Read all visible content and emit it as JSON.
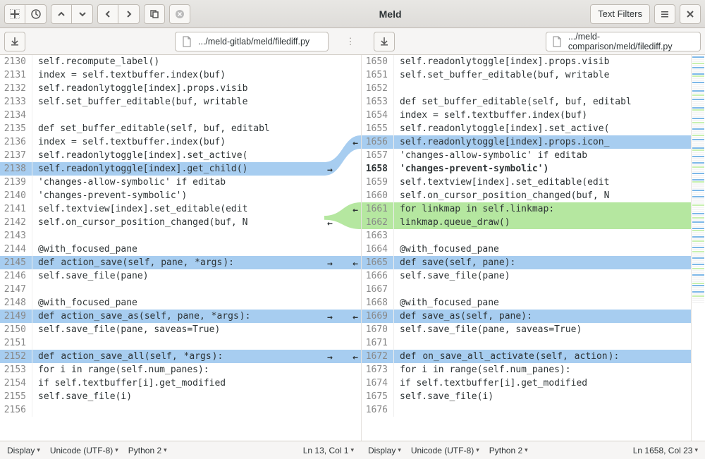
{
  "header": {
    "title": "Meld",
    "text_filters": "Text Filters"
  },
  "files": {
    "left": ".../meld-gitlab/meld/filediff.py",
    "right": ".../meld-comparison/meld/filediff.py"
  },
  "status": {
    "left": {
      "display": "Display",
      "encoding": "Unicode (UTF-8)",
      "lang": "Python 2",
      "pos": "Ln 13, Col 1"
    },
    "right": {
      "display": "Display",
      "encoding": "Unicode (UTF-8)",
      "lang": "Python 2",
      "pos": "Ln 1658, Col 23"
    }
  },
  "left_lines": [
    {
      "n": 2130,
      "t": "        self.recompute_label()",
      "bg": ""
    },
    {
      "n": 2131,
      "t": "        index = self.textbuffer.index(buf)",
      "bg": ""
    },
    {
      "n": 2132,
      "t": "        self.readonlytoggle[index].props.visib",
      "bg": ""
    },
    {
      "n": 2133,
      "t": "        self.set_buffer_editable(buf, writable",
      "bg": ""
    },
    {
      "n": 2134,
      "t": "",
      "bg": ""
    },
    {
      "n": 2135,
      "t": "    def set_buffer_editable(self, buf, editabl",
      "bg": ""
    },
    {
      "n": 2136,
      "t": "        index = self.textbuffer.index(buf)",
      "bg": ""
    },
    {
      "n": 2137,
      "t": "        self.readonlytoggle[index].set_active(",
      "bg": ""
    },
    {
      "n": 2138,
      "t": "        self.readonlytoggle[index].get_child()",
      "bg": "blue",
      "arrow_r": true
    },
    {
      "n": 2139,
      "t": "            'changes-allow-symbolic' if editab",
      "bg": ""
    },
    {
      "n": 2140,
      "t": "            'changes-prevent-symbolic')",
      "bg": ""
    },
    {
      "n": 2141,
      "t": "        self.textview[index].set_editable(edit",
      "bg": ""
    },
    {
      "n": 2142,
      "t": "        self.on_cursor_position_changed(buf, N",
      "bg": "",
      "arrow_l_green": true
    },
    {
      "n": 2143,
      "t": "",
      "bg": ""
    },
    {
      "n": 2144,
      "t": "    @with_focused_pane",
      "bg": ""
    },
    {
      "n": 2145,
      "t": "    def action_save(self, pane, *args):",
      "bg": "blue",
      "arrow_r": true,
      "hl": [
        "action_",
        "*args"
      ]
    },
    {
      "n": 2146,
      "t": "        self.save_file(pane)",
      "bg": ""
    },
    {
      "n": 2147,
      "t": "",
      "bg": ""
    },
    {
      "n": 2148,
      "t": "    @with_focused_pane",
      "bg": ""
    },
    {
      "n": 2149,
      "t": "    def action_save_as(self, pane, *args):",
      "bg": "blue",
      "arrow_r": true,
      "hl": [
        "action_",
        "*args"
      ]
    },
    {
      "n": 2150,
      "t": "        self.save_file(pane, saveas=True)",
      "bg": ""
    },
    {
      "n": 2151,
      "t": "",
      "bg": ""
    },
    {
      "n": 2152,
      "t": "    def action_save_all(self, *args):",
      "bg": "blue",
      "arrow_r": true,
      "hl": [
        "action_",
        "*args"
      ]
    },
    {
      "n": 2153,
      "t": "        for i in range(self.num_panes):",
      "bg": ""
    },
    {
      "n": 2154,
      "t": "            if self.textbuffer[i].get_modified",
      "bg": ""
    },
    {
      "n": 2155,
      "t": "                self.save_file(i)",
      "bg": ""
    },
    {
      "n": 2156,
      "t": "",
      "bg": ""
    }
  ],
  "right_lines": [
    {
      "n": 1650,
      "t": "        self.readonlytoggle[index].props.visib",
      "bg": ""
    },
    {
      "n": 1651,
      "t": "        self.set_buffer_editable(buf, writable",
      "bg": ""
    },
    {
      "n": 1652,
      "t": "",
      "bg": ""
    },
    {
      "n": 1653,
      "t": "    def set_buffer_editable(self, buf, editabl",
      "bg": ""
    },
    {
      "n": 1654,
      "t": "        index = self.textbuffer.index(buf)",
      "bg": ""
    },
    {
      "n": 1655,
      "t": "        self.readonlytoggle[index].set_active(",
      "bg": ""
    },
    {
      "n": 1656,
      "t": "        self.readonlytoggle[index].props.icon_",
      "bg": "blue",
      "arrow_l": true
    },
    {
      "n": 1657,
      "t": "            'changes-allow-symbolic' if editab",
      "bg": ""
    },
    {
      "n": 1658,
      "t": "            'changes-prevent-symbolic')",
      "bg": "",
      "bold": true
    },
    {
      "n": 1659,
      "t": "        self.textview[index].set_editable(edit",
      "bg": ""
    },
    {
      "n": 1660,
      "t": "        self.on_cursor_position_changed(buf, N",
      "bg": ""
    },
    {
      "n": 1661,
      "t": "        for linkmap in self.linkmap:",
      "bg": "green",
      "arrow_l": true
    },
    {
      "n": 1662,
      "t": "            linkmap.queue_draw()",
      "bg": "green"
    },
    {
      "n": 1663,
      "t": "",
      "bg": ""
    },
    {
      "n": 1664,
      "t": "    @with_focused_pane",
      "bg": ""
    },
    {
      "n": 1665,
      "t": "    def save(self, pane):",
      "bg": "blue",
      "arrow_l": true
    },
    {
      "n": 1666,
      "t": "        self.save_file(pane)",
      "bg": ""
    },
    {
      "n": 1667,
      "t": "",
      "bg": ""
    },
    {
      "n": 1668,
      "t": "    @with_focused_pane",
      "bg": ""
    },
    {
      "n": 1669,
      "t": "    def save_as(self, pane):",
      "bg": "blue",
      "arrow_l": true
    },
    {
      "n": 1670,
      "t": "        self.save_file(pane, saveas=True)",
      "bg": ""
    },
    {
      "n": 1671,
      "t": "",
      "bg": ""
    },
    {
      "n": 1672,
      "t": "    def on_save_all_activate(self, action):",
      "bg": "blue",
      "arrow_l": true,
      "hl": [
        "on_",
        "_activate",
        "action"
      ]
    },
    {
      "n": 1673,
      "t": "        for i in range(self.num_panes):",
      "bg": ""
    },
    {
      "n": 1674,
      "t": "            if self.textbuffer[i].get_modified",
      "bg": ""
    },
    {
      "n": 1675,
      "t": "                self.save_file(i)",
      "bg": ""
    },
    {
      "n": 1676,
      "t": "",
      "bg": ""
    }
  ]
}
